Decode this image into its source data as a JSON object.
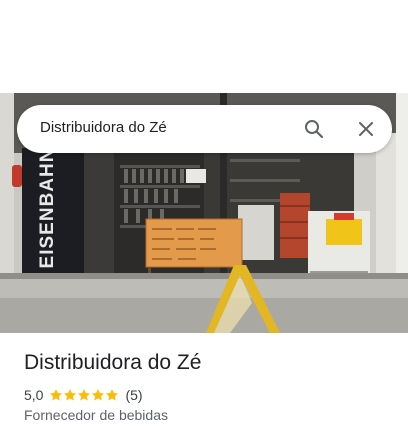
{
  "search": {
    "query": "Distribuidora do Zé"
  },
  "icons": {
    "search": "search-icon",
    "close": "close-icon"
  },
  "photo": {
    "description_icon": "storefront-photo",
    "sign_text": "EISENBAHN"
  },
  "place": {
    "name": "Distribuidora do Zé",
    "rating": "5,0",
    "stars": 5,
    "review_count": "(5)",
    "category": "Fornecedor de bebidas"
  },
  "colors": {
    "star": "#fbbc04",
    "text_primary": "#202124",
    "text_secondary": "#5f6368",
    "icon": "#5f6368"
  }
}
